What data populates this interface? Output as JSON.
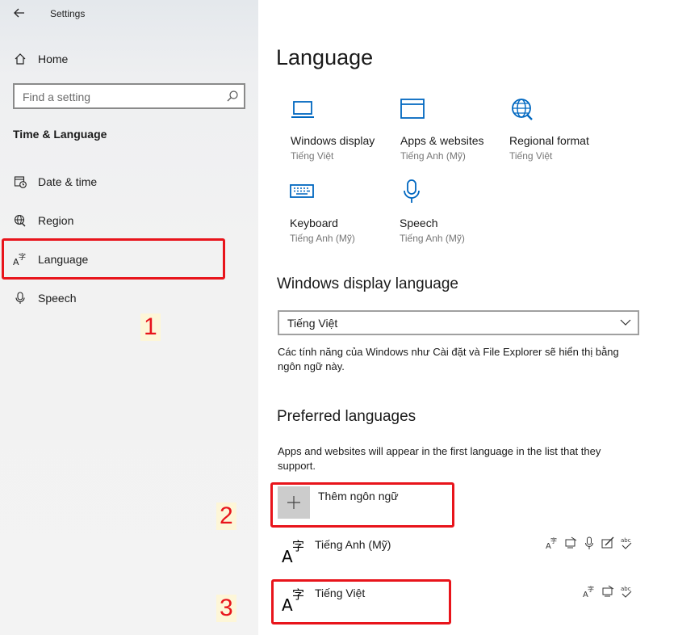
{
  "window": {
    "title": "Settings"
  },
  "sidebar": {
    "home_label": "Home",
    "search_placeholder": "Find a setting",
    "section_title": "Time & Language",
    "items": [
      {
        "label": "Date & time",
        "icon": "calendar-clock-icon"
      },
      {
        "label": "Region",
        "icon": "globe-icon"
      },
      {
        "label": "Language",
        "icon": "language-icon"
      },
      {
        "label": "Speech",
        "icon": "microphone-icon"
      }
    ]
  },
  "main": {
    "title": "Language",
    "tiles": [
      {
        "label": "Windows display",
        "value": "Tiếng Việt",
        "icon": "laptop-icon"
      },
      {
        "label": "Apps & websites",
        "value": "Tiếng Anh (Mỹ)",
        "icon": "window-icon"
      },
      {
        "label": "Regional format",
        "value": "Tiếng Việt",
        "icon": "globe-settings-icon"
      },
      {
        "label": "Keyboard",
        "value": "Tiếng Anh (Mỹ)",
        "icon": "keyboard-icon"
      },
      {
        "label": "Speech",
        "value": "Tiếng Anh (Mỹ)",
        "icon": "microphone-icon"
      }
    ],
    "display_language": {
      "heading": "Windows display language",
      "selected": "Tiếng Việt",
      "description": "Các tính năng của Windows như Cài đặt và File Explorer sẽ hiển thị bằng ngôn ngữ này."
    },
    "preferred": {
      "heading": "Preferred languages",
      "description": "Apps and websites will appear in the first language in the list that they support.",
      "add_label": "Thêm ngôn ngữ",
      "languages": [
        {
          "name": "Tiếng Anh (Mỹ)",
          "features": [
            "display-language-icon",
            "text-to-speech-icon",
            "speech-recognition-icon",
            "handwriting-icon",
            "spell-check-icon"
          ]
        },
        {
          "name": "Tiếng Việt",
          "features": [
            "display-language-icon",
            "text-to-speech-icon",
            "spell-check-icon"
          ]
        }
      ]
    }
  },
  "annotations": {
    "step1": "1",
    "step2": "2",
    "step3": "3"
  },
  "colors": {
    "accent": "#0067c0",
    "highlight_red": "#e8141b",
    "sidebar_bg": "#f2f2f2"
  }
}
